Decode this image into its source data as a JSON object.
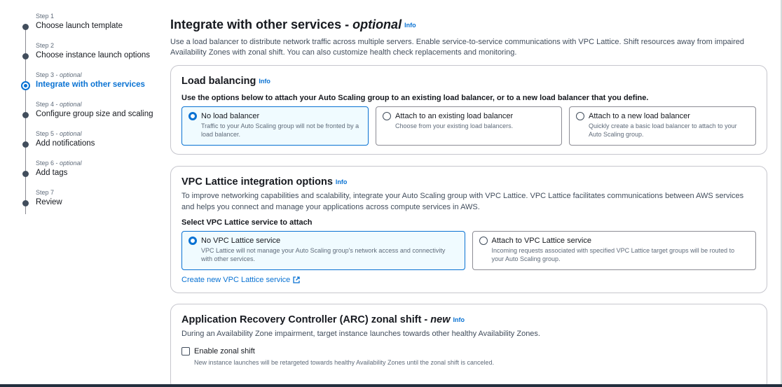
{
  "sidebar": {
    "steps": [
      {
        "label": "Step 1",
        "optional": "",
        "title": "Choose launch template"
      },
      {
        "label": "Step 2",
        "optional": "",
        "title": "Choose instance launch options"
      },
      {
        "label": "Step 3 - ",
        "optional": "optional",
        "title": "Integrate with other services"
      },
      {
        "label": "Step 4 - ",
        "optional": "optional",
        "title": "Configure group size and scaling"
      },
      {
        "label": "Step 5 - ",
        "optional": "optional",
        "title": "Add notifications"
      },
      {
        "label": "Step 6 - ",
        "optional": "optional",
        "title": "Add tags"
      },
      {
        "label": "Step 7",
        "optional": "",
        "title": "Review"
      }
    ],
    "active_step": 3
  },
  "header": {
    "title": "Integrate with other services - ",
    "title_emphasis": "optional",
    "info": "Info",
    "description": "Use a load balancer to distribute network traffic across multiple servers. Enable service-to-service communications with VPC Lattice. Shift resources away from impaired Availability Zones with zonal shift. You can also customize health check replacements and monitoring."
  },
  "load_balancing": {
    "title": "Load balancing",
    "info": "Info",
    "question": "Use the options below to attach your Auto Scaling group to an existing load balancer, or to a new load balancer that you define.",
    "options": [
      {
        "title": "No load balancer",
        "desc": "Traffic to your Auto Scaling group will not be fronted by a load balancer.",
        "selected": true
      },
      {
        "title": "Attach to an existing load balancer",
        "desc": "Choose from your existing load balancers.",
        "selected": false
      },
      {
        "title": "Attach to a new load balancer",
        "desc": "Quickly create a basic load balancer to attach to your Auto Scaling group.",
        "selected": false
      }
    ]
  },
  "vpc_lattice": {
    "title": "VPC Lattice integration options",
    "info": "Info",
    "description": "To improve networking capabilities and scalability, integrate your Auto Scaling group with VPC Lattice. VPC Lattice facilitates communications between AWS services and helps you connect and manage your applications across compute services in AWS.",
    "question": "Select VPC Lattice service to attach",
    "options": [
      {
        "title": "No VPC Lattice service",
        "desc": "VPC Lattice will not manage your Auto Scaling group's network access and connectivity with other services.",
        "selected": true
      },
      {
        "title": "Attach to VPC Lattice service",
        "desc": "Incoming requests associated with specified VPC Lattice target groups will be routed to your Auto Scaling group.",
        "selected": false
      }
    ],
    "create_link": "Create new VPC Lattice service"
  },
  "zonal_shift": {
    "title": "Application Recovery Controller (ARC) zonal shift - ",
    "title_emphasis": "new",
    "info": "Info",
    "description": "During an Availability Zone impairment, target instance launches towards other healthy Availability Zones.",
    "checkbox_label": "Enable zonal shift",
    "checkbox_checked": false,
    "checkbox_desc": "New instance launches will be retargeted towards healthy Availability Zones until the zonal shift is canceled."
  },
  "colors": {
    "accent": "#0972d3",
    "selected_tile_bg": "#f0fbff",
    "bottom_bar": "#232f3e"
  }
}
